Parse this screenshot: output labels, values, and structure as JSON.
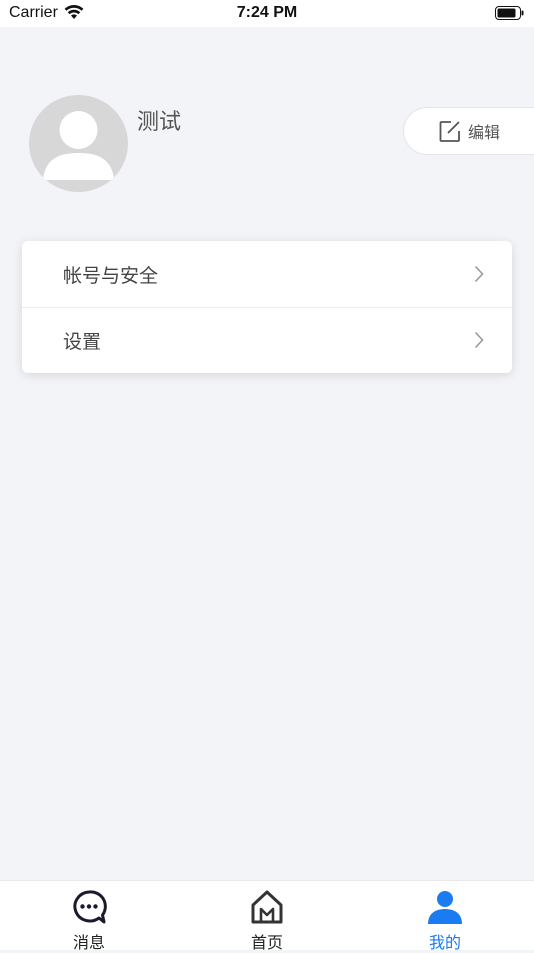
{
  "status_bar": {
    "carrier": "Carrier",
    "time": "7:24 PM"
  },
  "profile": {
    "name": "测试",
    "edit_label": "编辑"
  },
  "menu": [
    {
      "label": "帐号与安全"
    },
    {
      "label": "设置"
    }
  ],
  "tabs": [
    {
      "label": "消息",
      "icon": "message-icon",
      "active": false
    },
    {
      "label": "首页",
      "icon": "home-icon",
      "active": false
    },
    {
      "label": "我的",
      "icon": "person-icon",
      "active": true
    }
  ],
  "colors": {
    "accent": "#1b7cf2",
    "background": "#f3f4f8"
  }
}
